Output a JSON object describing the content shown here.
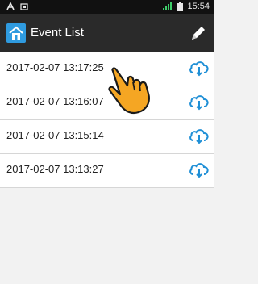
{
  "status_bar": {
    "time": "15:54",
    "icons": [
      "a-notification-icon",
      "photo-notification-icon",
      "signal-icon",
      "battery-icon"
    ]
  },
  "app_bar": {
    "title": "Event List",
    "left_icon": "home-icon",
    "right_icon": "pencil-icon"
  },
  "events": [
    {
      "timestamp": "2017-02-07 13:17:25"
    },
    {
      "timestamp": "2017-02-07 13:16:07"
    },
    {
      "timestamp": "2017-02-07 13:15:14"
    },
    {
      "timestamp": "2017-02-07 13:13:27"
    }
  ],
  "colors": {
    "accent": "#1f8fd6",
    "appbar": "#2a2a2a",
    "statusbar": "#111111",
    "hand": "#f5a623"
  }
}
